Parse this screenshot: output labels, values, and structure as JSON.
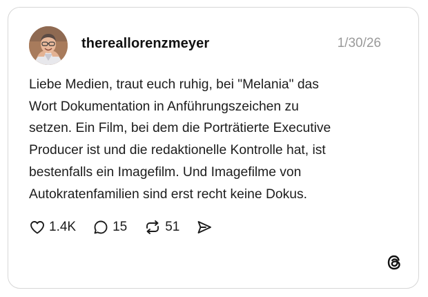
{
  "post": {
    "username": "thereallorenzmeyer",
    "date": "1/30/26",
    "text": "Liebe Medien, traut euch ruhig, bei \"Melania\" das\nWort Dokumentation in Anführungszeichen zu\nsetzen. Ein Film, bei dem die Porträtierte Executive\nProducer ist und die redaktionelle Kontrolle hat, ist\nbestenfalls ein Imagefilm. Und Imagefilme von\nAutokratenfamilien sind erst recht keine Dokus."
  },
  "actions": {
    "likes": "1.4K",
    "replies": "15",
    "reposts": "51"
  },
  "icons": {
    "like": "heart-icon",
    "reply": "speech-bubble-icon",
    "repost": "repost-arrows-icon",
    "share": "send-icon",
    "brand": "threads-logo-icon"
  }
}
